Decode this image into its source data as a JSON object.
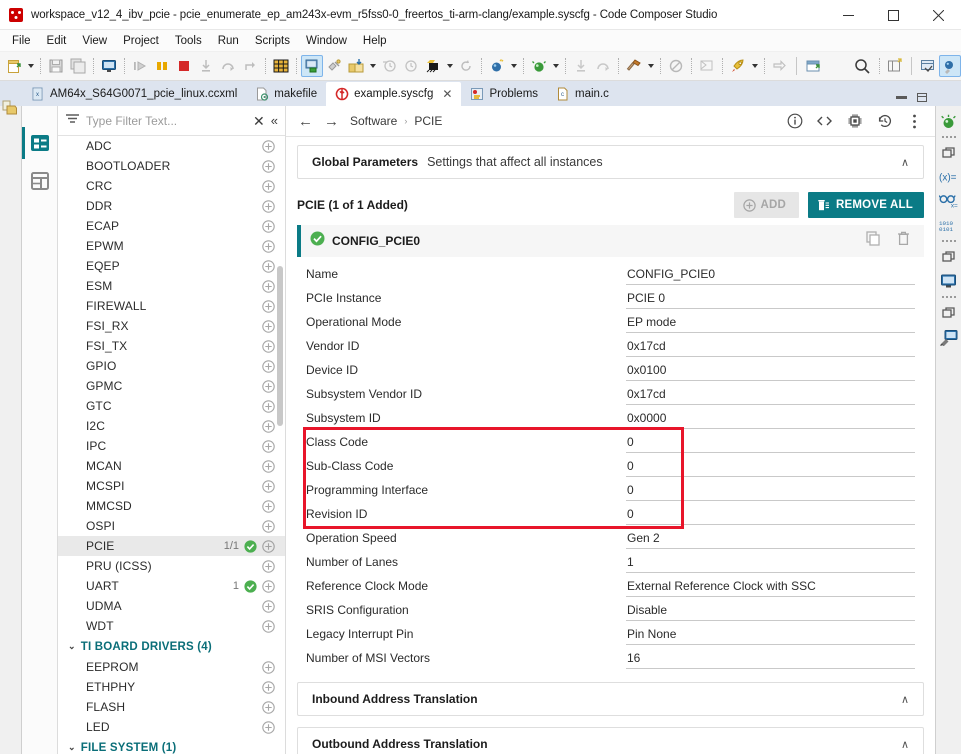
{
  "window": {
    "title": "workspace_v12_4_ibv_pcie - pcie_enumerate_ep_am243x-evm_r5fss0-0_freertos_ti-arm-clang/example.syscfg - Code Composer Studio",
    "minimize": "—",
    "maximize": "☐",
    "close": "✕"
  },
  "menu": {
    "items": [
      "File",
      "Edit",
      "View",
      "Project",
      "Tools",
      "Run",
      "Scripts",
      "Window",
      "Help"
    ]
  },
  "tabs": [
    {
      "label": "AM64x_S64G0071_pcie_linux.ccxml",
      "icon": "ccxml-file-icon",
      "active": false,
      "closable": false
    },
    {
      "label": "makefile",
      "icon": "makefile-icon",
      "active": false,
      "closable": false
    },
    {
      "label": "example.syscfg",
      "icon": "syscfg-icon",
      "active": true,
      "closable": true,
      "close": "✕"
    },
    {
      "label": "Problems",
      "icon": "problems-icon",
      "active": false,
      "closable": false
    },
    {
      "label": "main.c",
      "icon": "c-file-icon",
      "active": false,
      "closable": false
    }
  ],
  "filter": {
    "placeholder": "Type Filter Text...",
    "value": "",
    "clear": "✕",
    "collapse": "«"
  },
  "modules": [
    {
      "label": "ADC",
      "count": "",
      "check": false
    },
    {
      "label": "BOOTLOADER",
      "count": "",
      "check": false
    },
    {
      "label": "CRC",
      "count": "",
      "check": false
    },
    {
      "label": "DDR",
      "count": "",
      "check": false
    },
    {
      "label": "ECAP",
      "count": "",
      "check": false
    },
    {
      "label": "EPWM",
      "count": "",
      "check": false
    },
    {
      "label": "EQEP",
      "count": "",
      "check": false
    },
    {
      "label": "ESM",
      "count": "",
      "check": false
    },
    {
      "label": "FIREWALL",
      "count": "",
      "check": false
    },
    {
      "label": "FSI_RX",
      "count": "",
      "check": false
    },
    {
      "label": "FSI_TX",
      "count": "",
      "check": false
    },
    {
      "label": "GPIO",
      "count": "",
      "check": false
    },
    {
      "label": "GPMC",
      "count": "",
      "check": false
    },
    {
      "label": "GTC",
      "count": "",
      "check": false
    },
    {
      "label": "I2C",
      "count": "",
      "check": false
    },
    {
      "label": "IPC",
      "count": "",
      "check": false
    },
    {
      "label": "MCAN",
      "count": "",
      "check": false
    },
    {
      "label": "MCSPI",
      "count": "",
      "check": false
    },
    {
      "label": "MMCSD",
      "count": "",
      "check": false
    },
    {
      "label": "OSPI",
      "count": "",
      "check": false
    },
    {
      "label": "PCIE",
      "count": "1/1",
      "check": true,
      "selected": true
    },
    {
      "label": "PRU (ICSS)",
      "count": "",
      "check": false
    },
    {
      "label": "UART",
      "count": "1",
      "check": true
    },
    {
      "label": "UDMA",
      "count": "",
      "check": false
    },
    {
      "label": "WDT",
      "count": "",
      "check": false
    }
  ],
  "groups": [
    {
      "label": "TI BOARD DRIVERS (4)",
      "chev": "⌄",
      "items": [
        {
          "label": "EEPROM"
        },
        {
          "label": "ETHPHY"
        },
        {
          "label": "FLASH"
        },
        {
          "label": "LED"
        }
      ]
    },
    {
      "label": "FILE SYSTEM (1)",
      "chev": "⌄",
      "items": []
    }
  ],
  "breadcrumb": {
    "back": "←",
    "forward": "→",
    "items": [
      "Software",
      "PCIE"
    ],
    "separator": "›",
    "actions": [
      "info-icon",
      "code-icon",
      "device-chip-icon",
      "history-icon",
      "more-options-icon"
    ]
  },
  "global_params": {
    "title": "Global Parameters",
    "subtitle": "Settings that affect all instances",
    "caret": "∧"
  },
  "section": {
    "title": "PCIE (1 of 1 Added)",
    "add_label": "ADD",
    "remove_label": "REMOVE ALL"
  },
  "instance": {
    "name": "CONFIG_PCIE0",
    "status": "valid",
    "copy_icon": "duplicate-icon",
    "delete_icon": "trash-icon"
  },
  "fields": [
    {
      "label": "Name",
      "value": "CONFIG_PCIE0",
      "type": "text"
    },
    {
      "label": "PCIe Instance",
      "value": "PCIE 0",
      "type": "select"
    },
    {
      "label": "Operational Mode",
      "value": "EP mode",
      "type": "select"
    },
    {
      "label": "Vendor ID",
      "value": "0x17cd",
      "type": "text",
      "cursor": true
    },
    {
      "label": "Device ID",
      "value": "0x0100",
      "type": "text"
    },
    {
      "label": "Subsystem Vendor ID",
      "value": "0x17cd",
      "type": "text"
    },
    {
      "label": "Subsystem ID",
      "value": "0x0000",
      "type": "text"
    },
    {
      "label": "Class Code",
      "value": "0",
      "type": "text",
      "highlighted": true
    },
    {
      "label": "Sub-Class Code",
      "value": "0",
      "type": "text",
      "highlighted": true
    },
    {
      "label": "Programming Interface",
      "value": "0",
      "type": "text",
      "highlighted": true
    },
    {
      "label": "Revision ID",
      "value": "0",
      "type": "text",
      "highlighted": true
    },
    {
      "label": "Operation Speed",
      "value": "Gen 2",
      "type": "select"
    },
    {
      "label": "Number of Lanes",
      "value": "1",
      "type": "text"
    },
    {
      "label": "Reference Clock Mode",
      "value": "External Reference Clock with SSC",
      "type": "select"
    },
    {
      "label": "SRIS Configuration",
      "value": "Disable",
      "type": "select"
    },
    {
      "label": "Legacy Interrupt Pin",
      "value": "Pin None",
      "type": "select"
    },
    {
      "label": "Number of MSI Vectors",
      "value": "16",
      "type": "select"
    }
  ],
  "collapsibles": [
    {
      "label": "Inbound Address Translation",
      "caret": "∧"
    },
    {
      "label": "Outbound Address Translation",
      "caret": "∧"
    }
  ],
  "colors": {
    "accent_teal": "#0b7b86",
    "highlight_red": "#e8152a",
    "valid_green": "#4caf50",
    "group_header": "#0a6e78"
  }
}
